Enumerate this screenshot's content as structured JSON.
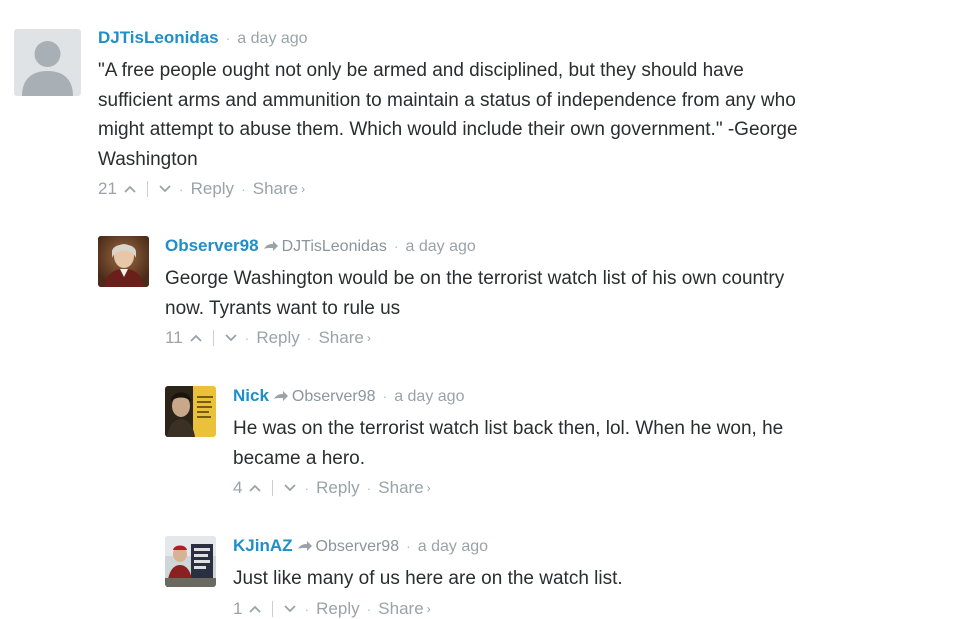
{
  "comments": [
    {
      "author": "DJTisLeonidas",
      "parent": "",
      "time": "a day ago",
      "text_lines": [
        "\"A free people ought not only be armed and disciplined, but they should have",
        "sufficient arms and ammunition to maintain a status of independence from any who",
        "might attempt to abuse them. Which would include their own government.\" -George",
        "Washington"
      ],
      "votes": "21",
      "reply_label": "Reply",
      "share_label": "Share"
    },
    {
      "author": "Observer98",
      "parent": "DJTisLeonidas",
      "time": "a day ago",
      "text_lines": [
        "George Washington would be on the terrorist watch list of his own country",
        "now. Tyrants want to rule us"
      ],
      "votes": "11",
      "reply_label": "Reply",
      "share_label": "Share"
    },
    {
      "author": "Nick",
      "parent": "Observer98",
      "time": "a day ago",
      "text_lines": [
        "He was on the terrorist watch list back then, lol. When he won, he",
        "became a hero."
      ],
      "votes": "4",
      "reply_label": "Reply",
      "share_label": "Share"
    },
    {
      "author": "KJinAZ",
      "parent": "Observer98",
      "time": "a day ago",
      "text_lines": [
        "Just like many of us here are on the watch list."
      ],
      "votes": "1",
      "reply_label": "Reply",
      "share_label": "Share"
    }
  ],
  "separator_dot": "·",
  "icons": {
    "upvote": "chevron-up-icon",
    "downvote": "chevron-down-icon",
    "reply_to": "reply-arrow-icon",
    "share_more": "chevron-right-icon"
  },
  "colors": {
    "author": "#1e8fc8",
    "meta": "#9aa3a8",
    "text": "#2a2e2e"
  }
}
